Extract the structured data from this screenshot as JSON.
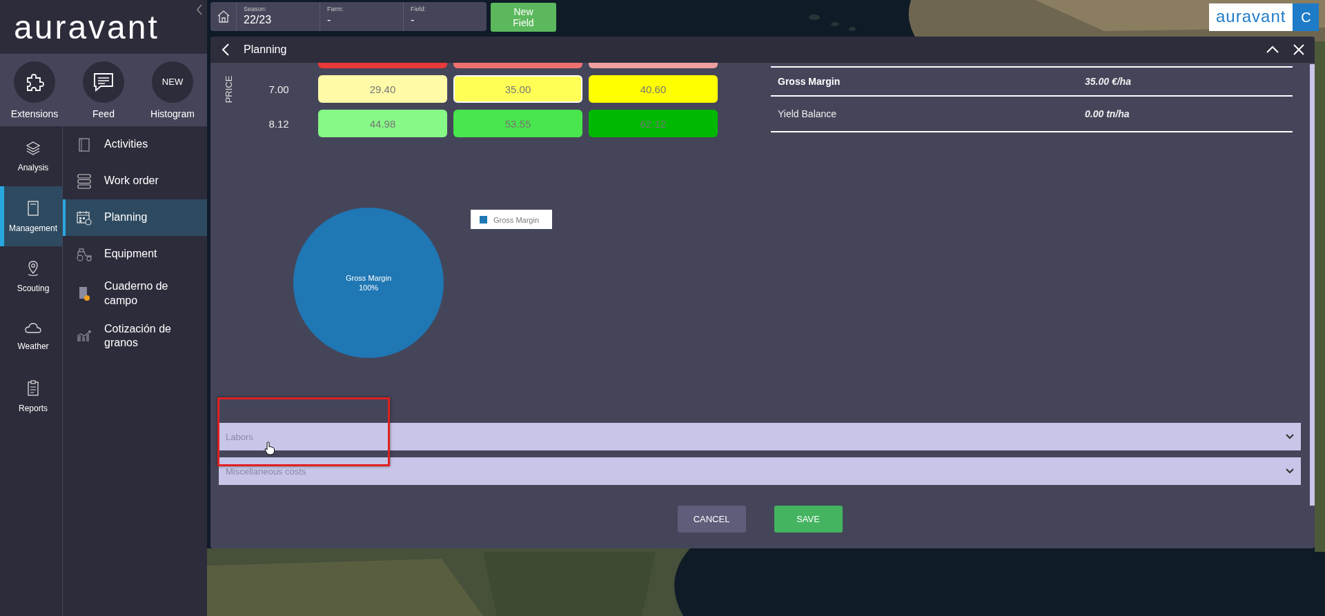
{
  "logo": "auravant",
  "quick_actions": [
    {
      "label": "Extensions",
      "kind": "icon"
    },
    {
      "label": "Feed",
      "kind": "icon"
    },
    {
      "label": "Histogram",
      "kind": "badge",
      "badge": "NEW"
    }
  ],
  "nav": [
    {
      "label": "Analysis",
      "selected": false
    },
    {
      "label": "Management",
      "selected": true
    },
    {
      "label": "Scouting",
      "selected": false
    },
    {
      "label": "Weather",
      "selected": false
    },
    {
      "label": "Reports",
      "selected": false
    }
  ],
  "submenu": [
    {
      "label": "Activities",
      "selected": false
    },
    {
      "label": "Work order",
      "selected": false
    },
    {
      "label": "Planning",
      "selected": true
    },
    {
      "label": "Equipment",
      "selected": false
    },
    {
      "label": "Cuaderno de campo",
      "selected": false
    },
    {
      "label": "Cotización de granos",
      "selected": false
    }
  ],
  "topbar": {
    "fields": [
      {
        "label": "Season:",
        "value": "22/23"
      },
      {
        "label": "Farm:",
        "value": "-"
      },
      {
        "label": "Field:",
        "value": "-"
      }
    ],
    "new_field_button": "New Field"
  },
  "brand": {
    "logo": "auravant",
    "avatar": "C"
  },
  "modal": {
    "title": "Planning",
    "price_axis": "PRICE",
    "price_rows": [
      {
        "cells": [
          {
            "color": "#e83a3a",
            "selected": false
          },
          {
            "color": "#f07070",
            "selected": false
          },
          {
            "color": "#eea0a0",
            "selected": false
          }
        ]
      },
      {
        "price": "7.00",
        "cells": [
          {
            "value": "29.40",
            "color": "#fffaa8",
            "selected": false
          },
          {
            "value": "35.00",
            "color": "#ffff55",
            "selected": true
          },
          {
            "value": "40.60",
            "color": "#ffff00",
            "selected": false
          }
        ]
      },
      {
        "price": "8.12",
        "cells": [
          {
            "value": "44.98",
            "color": "#86f986",
            "selected": false
          },
          {
            "value": "53.55",
            "color": "#48e64c",
            "selected": false
          },
          {
            "value": "62.12",
            "color": "#00b800",
            "selected": false
          }
        ]
      }
    ],
    "summary": [
      {
        "label": "Gross Margin",
        "value": "35.00 €/ha",
        "emphasized": true
      },
      {
        "label": "Yield Balance",
        "value": "0.00 tn/ha",
        "emphasized": false
      }
    ],
    "chart_data": {
      "type": "pie",
      "categories": [
        "Gross Margin"
      ],
      "series": [
        {
          "name": "Gross Margin",
          "color": "#1f77b4",
          "values": [
            100
          ]
        }
      ],
      "value_labels": [
        "100%"
      ]
    },
    "sections": [
      {
        "label": "Labors",
        "expanded": false
      },
      {
        "label": "Miscellaneous costs",
        "expanded": false
      }
    ],
    "buttons": [
      {
        "label": "CANCEL",
        "kind": "secondary"
      },
      {
        "label": "SAVE",
        "kind": "primary"
      }
    ]
  }
}
